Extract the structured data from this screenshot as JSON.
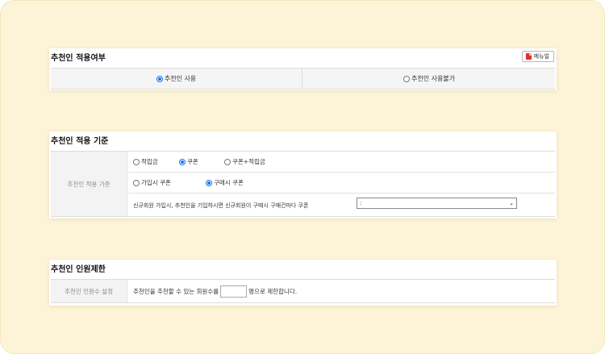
{
  "section1": {
    "title": "추천인 적용여부",
    "manual_label": "메뉴얼",
    "option_use": "추천인 사용",
    "option_nouse": "추천인 사용불가",
    "selected": "use"
  },
  "section2": {
    "title": "추천인 적용 기준",
    "row_label": "추천인 적용 기준",
    "reward_options": [
      "적립금",
      "쿠폰",
      "쿠폰+적립금"
    ],
    "reward_selected": "쿠폰",
    "timing_options": [
      "가입시 쿠폰",
      "구매시 쿠폰"
    ],
    "timing_selected": "구매시 쿠폰",
    "coupon_sentence": "신규회원 가입시, 추천인을 기입하시면 신규회원이 구매시 구매건마다 쿠폰",
    "coupon_select_value": ":"
  },
  "section3": {
    "title": "추천인 인원제한",
    "row_label": "추천인 인원수 설정",
    "text_before": "추천인을 추천할 수 있는 회원수를",
    "text_after": "명으로 제한합니다.",
    "input_value": ""
  },
  "colors": {
    "accent": "#1a73e8",
    "background": "#fdf4d8",
    "pdf_icon": "#e0302a"
  }
}
